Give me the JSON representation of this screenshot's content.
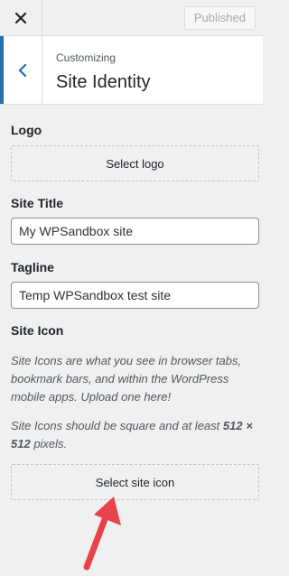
{
  "topbar": {
    "close_icon": "close-icon",
    "publish_label": "Published"
  },
  "section": {
    "back_icon": "chevron-left-icon",
    "breadcrumb": "Customizing",
    "title": "Site Identity"
  },
  "logo": {
    "label": "Logo",
    "button_label": "Select logo"
  },
  "site_title": {
    "label": "Site Title",
    "value": "My WPSandbox site"
  },
  "tagline": {
    "label": "Tagline",
    "value": "Temp WPSandbox test site"
  },
  "site_icon": {
    "label": "Site Icon",
    "description": "Site Icons are what you see in browser tabs, bookmark bars, and within the WordPress mobile apps. Upload one here!",
    "size_note_prefix": "Site Icons should be square and at least ",
    "size_note_value": "512 × 512",
    "size_note_suffix": " pixels.",
    "button_label": "Select site icon"
  },
  "colors": {
    "accent": "#2271b1",
    "annotation_arrow": "#e8424a"
  }
}
